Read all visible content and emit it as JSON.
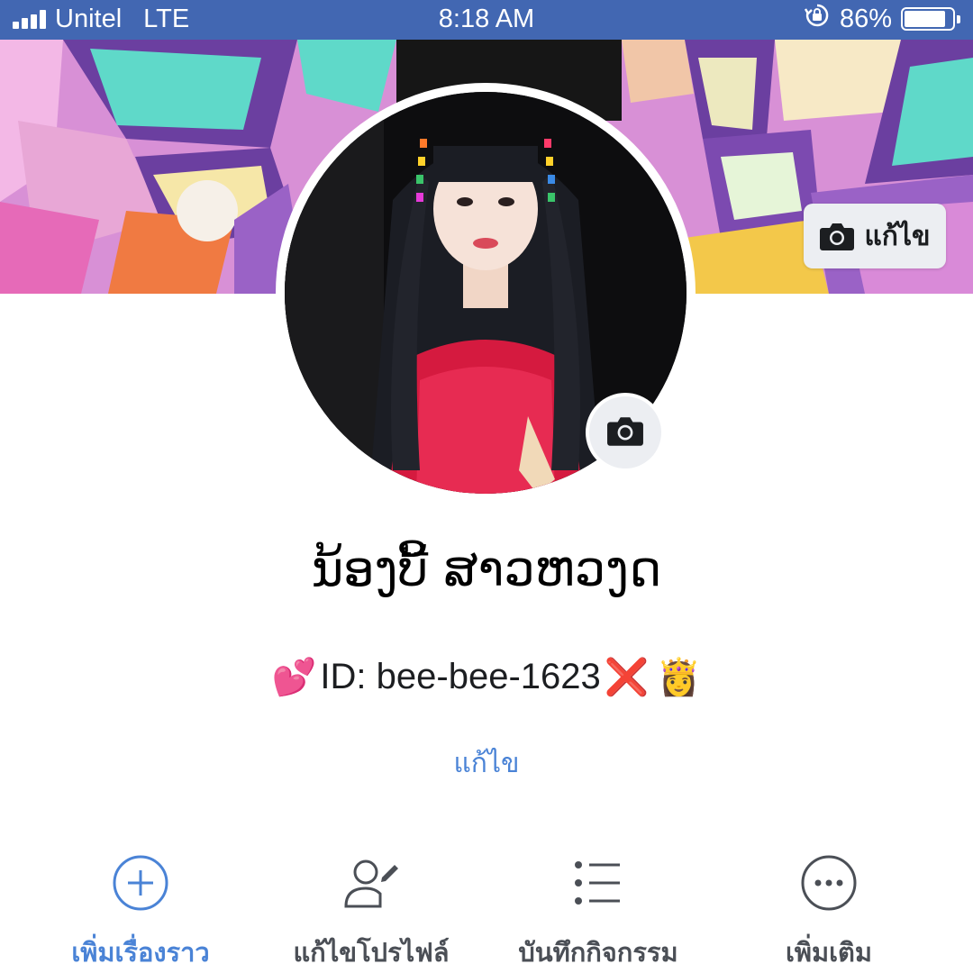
{
  "status_bar": {
    "carrier": "Unitel",
    "network": "LTE",
    "time": "8:18 AM",
    "battery_percent": "86%",
    "battery_level": 0.86
  },
  "cover": {
    "edit_label": "แก้ไข",
    "edit_icon": "camera-icon"
  },
  "profile": {
    "name": "ນ້ອງບີ້ ສາວຫວງດ",
    "bio_prefix_emoji": "💕",
    "bio_text": "ID:  bee-bee-1623",
    "bio_suffix_emoji_1": "❌",
    "bio_suffix_emoji_2": "👸",
    "edit_bio_label": "แก้ไข",
    "photo_icon": "camera-icon"
  },
  "actions": [
    {
      "label": "เพิ่มเรื่องราว",
      "icon": "plus-circle-icon",
      "active": true
    },
    {
      "label": "แก้ไขโปรไฟล์",
      "icon": "user-edit-icon",
      "active": false
    },
    {
      "label": "บันทึกกิจกรรม",
      "icon": "list-icon",
      "active": false
    },
    {
      "label": "เพิ่มเติม",
      "icon": "more-icon",
      "active": false
    }
  ],
  "colors": {
    "brand_blue": "#4267b2",
    "link_blue": "#4a83d6",
    "icon_gray": "#4b4f56"
  }
}
